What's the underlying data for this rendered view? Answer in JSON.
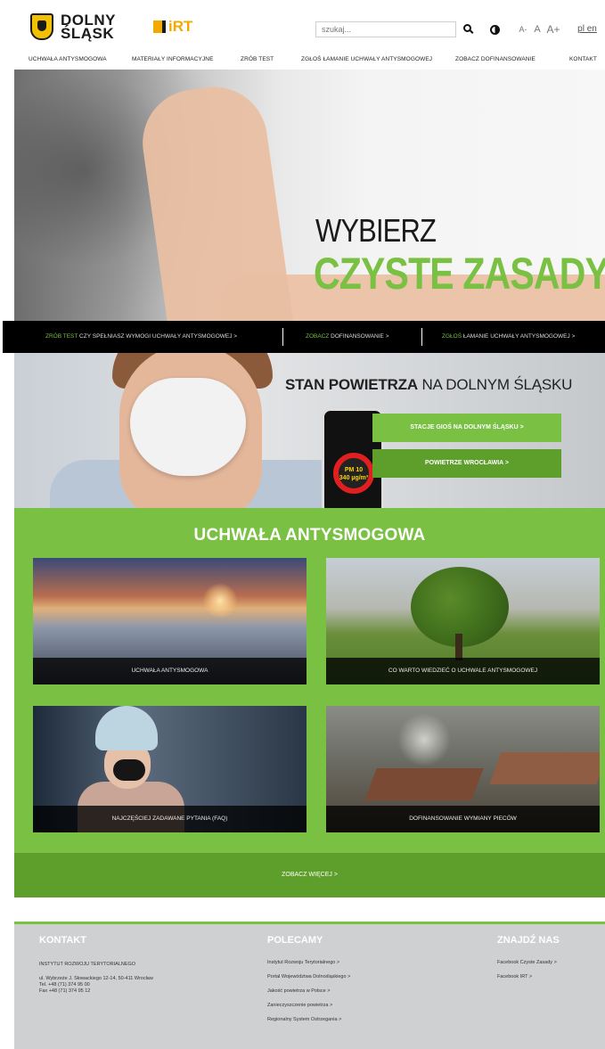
{
  "header": {
    "logo_main": "DOLNY\nŚLĄSK",
    "logo_irt": "iRT",
    "search_placeholder": "szukaj...",
    "font_small": "A-",
    "font_normal": "A",
    "font_large": "A+",
    "lang": "pl en"
  },
  "nav": {
    "items": [
      "UCHWAŁA ANTYSMOGOWA",
      "MATERIAŁY INFORMACYJNE",
      "ZRÓB TEST",
      "ZGŁOŚ ŁAMANIE UCHWAŁY ANTYSMOGOWEJ",
      "ZOBACZ DOFINANSOWANIE",
      "KONTAKT"
    ]
  },
  "hero": {
    "line1": "WYBIERZ",
    "line2": "CZYSTE ZASADY"
  },
  "link_bar": {
    "link1_highlight": "ZRÓB TEST",
    "link1_text": " CZY SPEŁNIASZ WYMOGI UCHWAŁY ANTYSMOGOWEJ >",
    "link2_highlight": "ZOBACZ",
    "link2_text": " DOFINANSOWANIE >",
    "link3_highlight": "ZGŁOŚ",
    "link3_text": " ŁAMANIE UCHWAŁY ANTYSMOGOWEJ >"
  },
  "air": {
    "title_bold": "STAN POWIETRZA",
    "title_rest": " NA DOLNYM ŚLĄSKU",
    "button1": "STACJE GIOŚ NA DOLNYM ŚLĄSKU >",
    "button2": "POWIETRZE WROCŁAWIA >",
    "pm_label": "PM 10",
    "pm_value": "340 µg/m³"
  },
  "smog": {
    "title": "UCHWAŁA ANTYSMOGOWA",
    "tiles": [
      "UCHWAŁA ANTYSMOGOWA",
      "CO WARTO WIEDZIEĆ O UCHWALE ANTYSMOGOWEJ",
      "NAJCZĘŚCIEJ ZADAWANE PYTANIA (FAQ)",
      "DOFINANSOWANIE WYMIANY PIECÓW"
    ],
    "see_more": "ZOBACZ WIĘCEJ >"
  },
  "footer": {
    "contact": {
      "heading": "KONTAKT",
      "org": "INSTYTUT ROZWOJU TERYTORIALNEGO",
      "address": "ul. Wybrzeże J. Słowackiego 12-14, 50-411 Wrocław",
      "tel": "Tel. +48 (71) 374 95 00",
      "fax": "Fax +48 (71) 374 95 12"
    },
    "recommend": {
      "heading": "POLECAMY",
      "links": [
        "Instytut Rozwoju Terytorialnego >",
        "Portal Województwa Dolnośląskiego >",
        "Jakość powietrza w Polsce >",
        "Zanieczyszczenie powietrza >",
        "Regionalny System Ostrzegania >"
      ]
    },
    "find": {
      "heading": "ZNAJDŹ NAS",
      "links": [
        "Facebook Czyste Zasady >",
        "Facebook IRT >"
      ]
    }
  },
  "colors": {
    "brand_green": "#7ac143",
    "dark_green": "#5e9e2a",
    "logo_yellow": "#f2c200",
    "irt_orange": "#f2a900"
  }
}
